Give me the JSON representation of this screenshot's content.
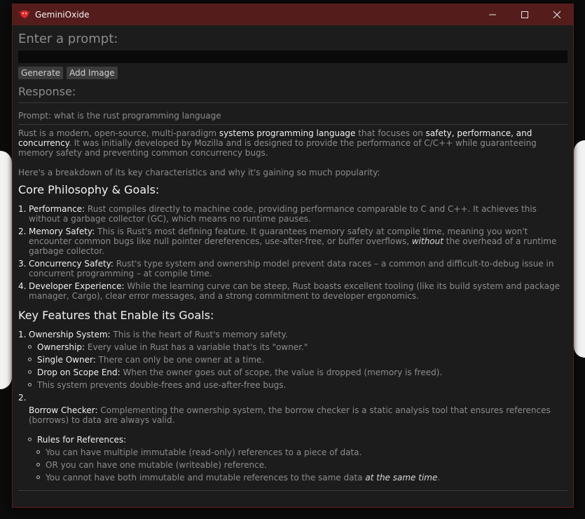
{
  "window": {
    "title": "GeminiOxide"
  },
  "prompt": {
    "label": "Enter a prompt:",
    "value": "",
    "placeholder": ""
  },
  "buttons": {
    "generate": "Generate",
    "add_image": "Add Image"
  },
  "response": {
    "label": "Response:",
    "prompt_echo": "Prompt: what is the rust programming language",
    "intro": {
      "a": "Rust is a modern, open-source, multi-paradigm ",
      "b": "systems programming language",
      "c": " that focuses on ",
      "d": "safety, performance, and concurrency",
      "e": ". It was initially developed by Mozilla and is designed to provide the performance of C/C++ while guaranteeing memory safety and preventing common concurrency bugs."
    },
    "breakdown": "Here's a breakdown of its key characteristics and why it's gaining so much popularity:",
    "section1": {
      "heading": "Core Philosophy & Goals:",
      "items": [
        {
          "num": "1.",
          "title": "Performance:",
          "text": " Rust compiles directly to machine code, providing performance comparable to C and C++. It achieves this without a garbage collector (GC), which means no runtime pauses."
        },
        {
          "num": "2.",
          "title": "Memory Safety:",
          "text": " This is Rust's most defining feature. It guarantees memory safety at compile time, meaning you won't encounter common bugs like null pointer dereferences, use-after-free, or buffer overflows, ",
          "em": "without",
          "tail": " the overhead of a runtime garbage collector."
        },
        {
          "num": "3.",
          "title": "Concurrency Safety:",
          "text": " Rust's type system and ownership model prevent data races – a common and difficult-to-debug issue in concurrent programming – at compile time."
        },
        {
          "num": "4.",
          "title": "Developer Experience:",
          "text": " While the learning curve can be steep, Rust boasts excellent tooling (like its build system and package manager, Cargo), clear error messages, and a strong commitment to developer ergonomics."
        }
      ]
    },
    "section2": {
      "heading": "Key Features that Enable its Goals:",
      "item1": {
        "num": "1.",
        "title": "Ownership System:",
        "text": " This is the heart of Rust's memory safety.",
        "bullets": [
          {
            "title": "Ownership:",
            "text": " Every value in Rust has a variable that's its \"owner.\""
          },
          {
            "title": "Single Owner:",
            "text": " There can only be one owner at a time."
          },
          {
            "title": "Drop on Scope End:",
            "text": " When the owner goes out of scope, the value is dropped (memory is freed)."
          },
          {
            "title": "",
            "text": "This system prevents double-frees and use-after-free bugs."
          }
        ]
      },
      "item2": {
        "num": "2.",
        "title": "Borrow Checker:",
        "text": " Complementing the ownership system, the borrow checker is a static analysis tool that ensures references (borrows) to data are always valid.",
        "rules_title": "Rules for References:",
        "rules": [
          "You can have multiple immutable (read-only) references to a piece of data.",
          "OR you can have one mutable (writeable) reference.",
          "You cannot have both immutable and mutable references to the same data "
        ],
        "rule_em": "at the same time",
        "rule_tail": "."
      }
    }
  },
  "icons": {
    "app": "crab-icon",
    "minimize": "minimize-icon",
    "maximize": "maximize-icon",
    "close": "close-icon"
  },
  "colors": {
    "titlebar": "#551c1c",
    "window_bg": "#1c1c1c",
    "accent_icon": "#e0282a"
  }
}
